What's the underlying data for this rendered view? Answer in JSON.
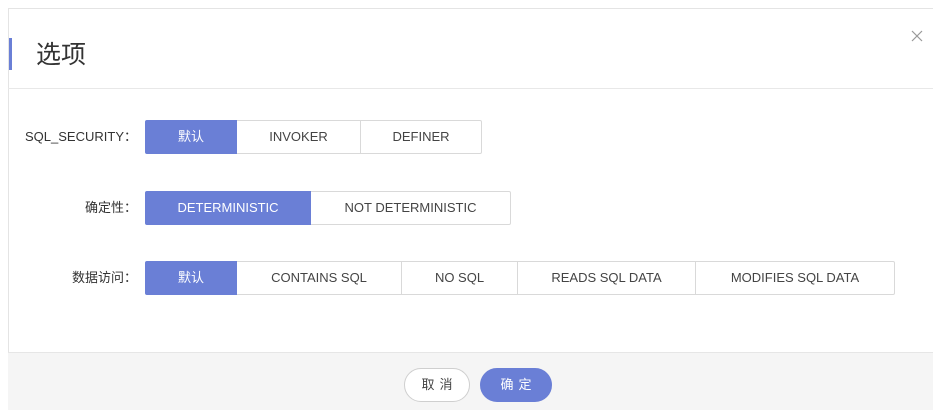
{
  "dialog": {
    "title": "选项",
    "close_icon": "close-icon"
  },
  "options": {
    "rows": [
      {
        "label": "SQL_SECURITY：",
        "choices": [
          "默认",
          "INVOKER",
          "DEFINER"
        ],
        "selected": "默认"
      },
      {
        "label": "确定性：",
        "choices": [
          "DETERMINISTIC",
          "NOT DETERMINISTIC"
        ],
        "selected": "DETERMINISTIC"
      },
      {
        "label": "数据访问：",
        "choices": [
          "默认",
          "CONTAINS SQL",
          "NO SQL",
          "READS SQL DATA",
          "MODIFIES SQL DATA"
        ],
        "selected": "默认"
      }
    ]
  },
  "footer": {
    "cancel_label": "取消",
    "confirm_label": "确定"
  },
  "colors": {
    "accent": "#6a7fd6",
    "footer_bg": "#f5f5f5",
    "border": "#d9d9d9"
  }
}
